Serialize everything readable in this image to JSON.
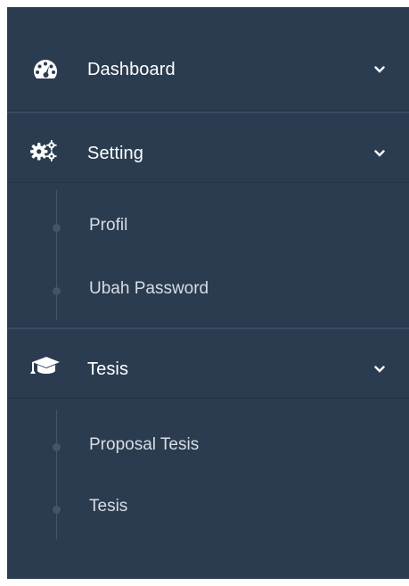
{
  "menu": {
    "dashboard": {
      "label": "Dashboard",
      "icon": "dashboard-gauge-icon"
    },
    "setting": {
      "label": "Setting",
      "icon": "gears-icon",
      "items": [
        {
          "label": "Profil"
        },
        {
          "label": "Ubah Password"
        }
      ]
    },
    "tesis": {
      "label": "Tesis",
      "icon": "graduation-cap-icon",
      "items": [
        {
          "label": "Proposal Tesis"
        },
        {
          "label": "Tesis"
        }
      ]
    }
  },
  "colors": {
    "sidebar_bg": "#2b3c50",
    "text": "#ffffff",
    "sub_text": "#d7dde5",
    "tree": "#435569"
  }
}
